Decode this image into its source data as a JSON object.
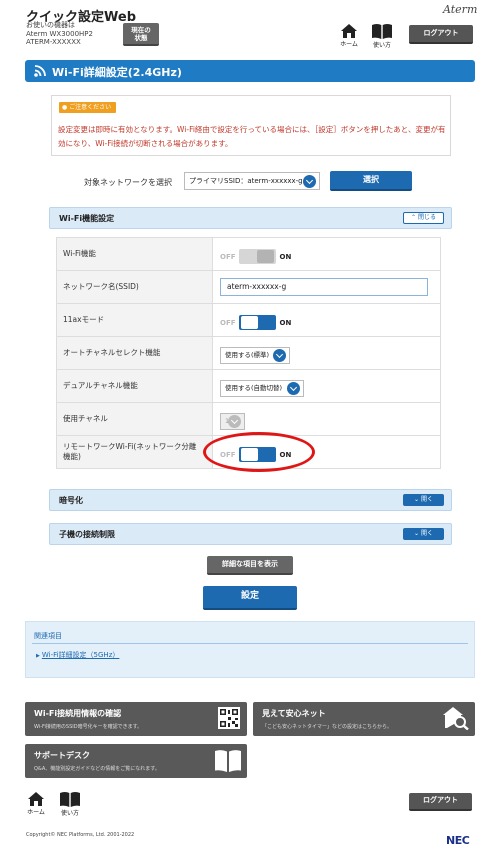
{
  "header": {
    "app_title": "クイック設定Web",
    "device_line1": "お使いの機器は",
    "device_line2": "Aterm WX3000HP2",
    "device_line3": "ATERM-XXXXXX",
    "status_button_line1": "現在の",
    "status_button_line2": "状態",
    "home_label": "ホーム",
    "manual_label": "使い方",
    "logout_label": "ログアウト",
    "brand": "Aterm"
  },
  "page_title": "Wi-Fi詳細設定(2.4GHz)",
  "notice": {
    "badge": "ご注意ください",
    "text": "設定変更は即時に有効となります。Wi-Fi経由で設定を行っている場合には、［設定］ボタンを押したあと、変更が有効になり、Wi-Fi接続が切断される場合があります。"
  },
  "network_select": {
    "label": "対象ネットワークを選択",
    "value": "プライマリSSID：aterm-xxxxxx-g",
    "button": "選択"
  },
  "wifi_section": {
    "title": "Wi-Fi機能設定",
    "toggle_label": "閉じる",
    "rows": {
      "wifi_function": {
        "label": "Wi-Fi機能",
        "off": "OFF",
        "on": "ON",
        "state": "off"
      },
      "ssid": {
        "label": "ネットワーク名(SSID)",
        "value": "aterm-xxxxxx-g"
      },
      "mode_11ax": {
        "label": "11axモード",
        "off": "OFF",
        "on": "ON",
        "state": "on"
      },
      "auto_channel": {
        "label": "オートチャネルセレクト機能",
        "value": "使用する(標準)"
      },
      "dual_channel": {
        "label": "デュアルチャネル機能",
        "value": "使用する(自動切替)"
      },
      "channel": {
        "label": "使用チャネル",
        "value": "1"
      },
      "remote_work": {
        "label_line1": "リモートワークWi-Fi(ネットワーク分離",
        "label_line2": "機能)",
        "off": "OFF",
        "on": "ON",
        "state": "on"
      }
    }
  },
  "encryption_section": {
    "title": "暗号化",
    "toggle_label": "開く"
  },
  "client_limit_section": {
    "title": "子機の接続制限",
    "toggle_label": "開く"
  },
  "show_details_button": "詳細な項目を表示",
  "save_button": "設定",
  "related": {
    "title": "関連項目",
    "link": "Wi-Fi詳細設定（5GHz）"
  },
  "footer_links": {
    "wifi_info": {
      "title": "Wi-Fi接続用情報の確認",
      "sub": "Wi-Fi接続用のSSID暗号化キーを確認できます。"
    },
    "safe_net": {
      "title": "見えて安心ネット",
      "sub": "「こども安心ネットタイマー」などの設定はこちらから。"
    },
    "support": {
      "title": "サポートデスク",
      "sub": "Q&A、機能別設定ガイドなどの情報をご覧になれます。"
    }
  },
  "footer": {
    "home_label": "ホーム",
    "manual_label": "使い方",
    "logout_label": "ログアウト",
    "copyright": "Copyright© NEC Platforms, Ltd. 2001-2022",
    "maker": "NEC"
  },
  "colors": {
    "primary": "#1e6ab0",
    "title_bar": "#1e7bc4",
    "warning": "#c0392b",
    "highlight_circle": "#e01515"
  }
}
